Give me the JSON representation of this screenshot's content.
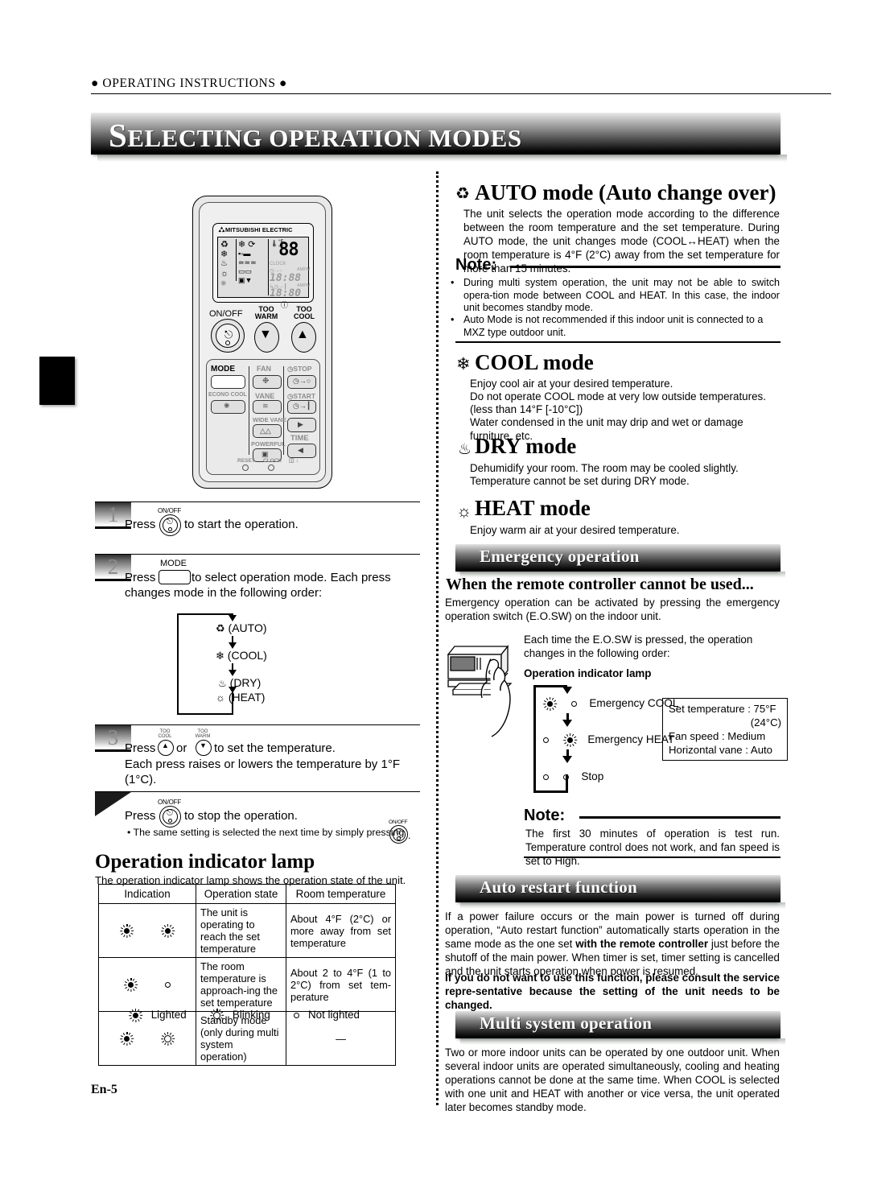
{
  "header": {
    "running_head": "● OPERATING INSTRUCTIONS ●",
    "title_cap": "S",
    "title_rest": "ELECTING OPERATION MODES"
  },
  "page_number": "En-5",
  "remote": {
    "brand": "MITSUBISHI ELECTRIC",
    "display_value": "88",
    "unit_f": "°F",
    "unit_c": "°C",
    "clock_label": "CLOCK",
    "time_1": "18:88",
    "time_2": "18:80",
    "ampm": "AMPM",
    "onoff_label": "ON/OFF",
    "too_warm_label": "TOO WARM",
    "too_cool_label": "TOO COOL",
    "keys": {
      "mode": "MODE",
      "econo_cool": "ECONO COOL",
      "fan": "FAN",
      "vane": "VANE",
      "wide_vane": "WIDE VANE",
      "powerful": "POWERFUL",
      "stop": "STOP",
      "start": "START",
      "time": "TIME",
      "reset": "RESET",
      "clock": "CLOCK"
    }
  },
  "steps": {
    "step1": {
      "number": "1",
      "key_label": "ON/OFF",
      "text_before": "Press",
      "text_after": "to start the operation."
    },
    "step2": {
      "number": "2",
      "key_label": "MODE",
      "text_before": "Press",
      "text_after": "to select operation mode. Each press",
      "text_line2": "changes mode in the following order:",
      "order": [
        {
          "icon": "auto-icon",
          "label": "(AUTO)"
        },
        {
          "icon": "cool-icon",
          "label": "(COOL)"
        },
        {
          "icon": "dry-icon",
          "label": "(DRY)"
        },
        {
          "icon": "heat-icon",
          "label": "(HEAT)"
        }
      ]
    },
    "step3": {
      "number": "3",
      "text_line1_a": "Press",
      "text_line1_b": "or",
      "text_line1_c": "to set the temperature.",
      "text_line2": "Each press raises or lowers the temperature by 1°F",
      "text_line3": "(1°C).",
      "up_caption": "TOO COOL",
      "down_caption": "TOO WARM"
    },
    "stop": {
      "key_label": "ON/OFF",
      "text_before": "Press",
      "text_after": "to stop the operation.",
      "bullet": "• The same setting is selected the next time by simply pressing",
      "bullet_key": "ON/OFF",
      "bullet_end": "."
    }
  },
  "indicator": {
    "heading": "Operation indicator lamp",
    "subtext": "The operation indicator lamp shows the operation state of the unit.",
    "columns": [
      "Indication",
      "Operation state",
      "Room temperature"
    ],
    "rows": [
      {
        "lamp_left": "lighted",
        "lamp_right": "lighted",
        "state": "The unit is operating to reach the set temperature",
        "room_temp": "About 4°F (2°C) or more away from set temperature"
      },
      {
        "lamp_left": "lighted",
        "lamp_right": "not-lighted",
        "state": "The room temperature is approach-ing the set temperature",
        "room_temp": "About 2 to 4°F (1 to 2°C) from set tem-perature"
      },
      {
        "lamp_left": "lighted",
        "lamp_right": "blinking",
        "state": "Standby mode (only during multi system operation)",
        "room_temp": "—"
      }
    ],
    "legend": [
      {
        "type": "lighted",
        "label": "Lighted"
      },
      {
        "type": "blinking",
        "label": "Blinking"
      },
      {
        "type": "not-lighted",
        "label": "Not lighted"
      }
    ]
  },
  "modes": {
    "auto": {
      "heading": "AUTO mode (Auto change over)",
      "body": "The unit selects the operation mode according to the difference between the room temperature and the set temperature. During AUTO mode, the unit changes mode (COOL↔HEAT) when the room temperature is 4°F (2°C) away from the set temperature for more than 15 minutes.",
      "note_label": "Note:",
      "note_items": [
        "During multi system operation, the unit may not be able to switch opera-tion mode between COOL and HEAT. In this case, the indoor unit becomes standby mode.",
        "Auto Mode is not recommended if this indoor unit is connected to a MXZ type outdoor unit."
      ]
    },
    "cool": {
      "heading": "COOL mode",
      "lines": [
        "Enjoy cool air at your desired temperature.",
        "Do not operate COOL mode at very low outside temperatures.",
        "(less than 14°F [-10°C])",
        "Water condensed in the unit may drip and wet or damage furniture, etc."
      ]
    },
    "dry": {
      "heading": "DRY mode",
      "lines": [
        "Dehumidify your room. The room may be cooled slightly.",
        "Temperature cannot be set during DRY mode."
      ]
    },
    "heat": {
      "heading": "HEAT mode",
      "lines": [
        "Enjoy warm air at your desired temperature."
      ]
    }
  },
  "emergency": {
    "banner": "Emergency operation",
    "subheading": "When the remote controller cannot be used...",
    "body": "Emergency operation can be activated by pressing the emergency operation switch (E.O.SW) on the indoor unit.",
    "order_intro": "Each time the E.O.SW is pressed, the operation changes in the following order:",
    "lamp_title": "Operation indicator lamp",
    "steps": [
      {
        "lamp_left": "lighted",
        "lamp_right": "not-lighted",
        "label": "Emergency COOL"
      },
      {
        "lamp_left": "not-lighted",
        "lamp_right": "lighted",
        "label": "Emergency HEAT"
      },
      {
        "lamp_left": "not-lighted",
        "lamp_right": "not-lighted",
        "label": "Stop"
      }
    ],
    "settings_box": [
      "Set temperature : 75°F",
      "(24°C)",
      "Fan speed : Medium",
      "Horizontal vane : Auto"
    ],
    "note_label": "Note:",
    "note_body": "The first 30 minutes of operation is test run. Temperature control does not work, and fan speed is set to High."
  },
  "auto_restart": {
    "banner": "Auto restart function",
    "para1_a": "If a power failure occurs or the main power is turned off during operation, “Auto restart function” automatically starts operation in the same mode as the one set ",
    "para1_bold": "with the remote controller",
    "para1_b": " just before the shutoff of the main power. When timer is set, timer setting is cancelled and the unit starts operation when power is resumed.",
    "para2": "If you do not want to use this function, please consult the service repre-sentative because the setting of the unit needs to be changed."
  },
  "multi_system": {
    "banner": "Multi system operation",
    "body": "Two or more indoor units can be operated by one outdoor unit. When several indoor units are operated simultaneously, cooling and heating operations cannot be done at the same time. When COOL is selected with one unit and HEAT with another or vice versa, the unit operated later becomes standby mode."
  },
  "colors": {
    "banner_top": "#e4e4e4",
    "banner_bottom": "#000000",
    "text": "#000000",
    "dim": "#9a9a9a"
  }
}
